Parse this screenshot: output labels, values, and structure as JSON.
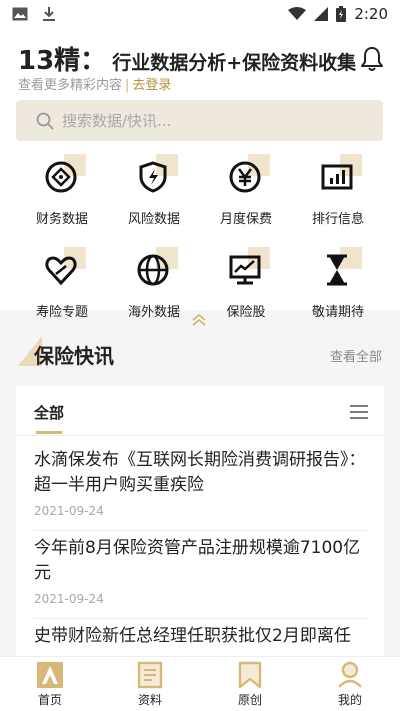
{
  "status_bar": {
    "time": "2:20",
    "icons": [
      "image-icon",
      "download-icon",
      "wifi-icon",
      "signal-icon",
      "battery-icon"
    ]
  },
  "header": {
    "title_main": "13精：",
    "title_sub": "行业数据分析+保险资料收集",
    "subtitle_text": "查看更多精彩内容",
    "subtitle_sep": "|",
    "login_link": "去登录"
  },
  "search": {
    "placeholder": "搜索数据/快讯..."
  },
  "menu_items": [
    {
      "label": "财务数据",
      "icon": "finance-icon"
    },
    {
      "label": "风险数据",
      "icon": "risk-shield-icon"
    },
    {
      "label": "月度保费",
      "icon": "yen-coin-icon"
    },
    {
      "label": "排行信息",
      "icon": "bar-chart-icon"
    },
    {
      "label": "寿险专题",
      "icon": "heart-icon"
    },
    {
      "label": "海外数据",
      "icon": "globe-icon"
    },
    {
      "label": "保险股",
      "icon": "stock-monitor-icon"
    },
    {
      "label": "敬请期待",
      "icon": "hourglass-icon"
    }
  ],
  "news": {
    "title": "保险快讯",
    "more": "查看全部",
    "tab_all": "全部",
    "items": [
      {
        "title": "水滴保发布《互联网长期险消费调研报告》：超一半用户购买重疾险",
        "date": "2021-09-24"
      },
      {
        "title": "今年前8月保险资管产品注册规模逾7100亿元",
        "date": "2021-09-24"
      },
      {
        "title": "史带财险新任总经理任职获批仅2月即离任",
        "date": ""
      }
    ]
  },
  "tab_bar": [
    {
      "label": "首页",
      "icon": "home-icon",
      "active": true
    },
    {
      "label": "资料",
      "icon": "document-icon",
      "active": false
    },
    {
      "label": "原创",
      "icon": "bookmark-icon",
      "active": false
    },
    {
      "label": "我的",
      "icon": "user-icon",
      "active": false
    }
  ],
  "colors": {
    "accent": "#d8b878",
    "accent_dark": "#b8903c",
    "search_bg": "#efe9dd"
  }
}
